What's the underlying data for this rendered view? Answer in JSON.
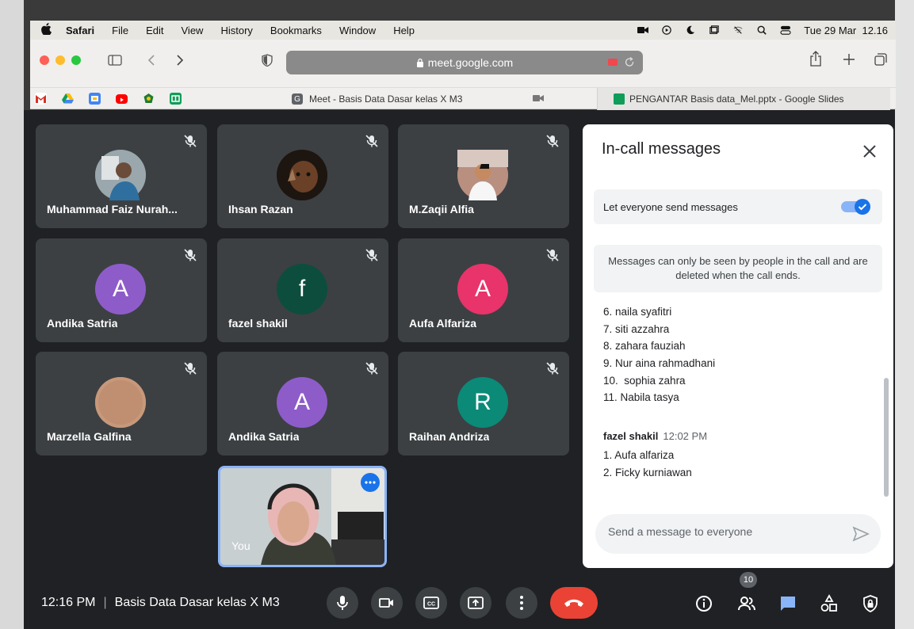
{
  "menubar": {
    "app": "Safari",
    "items": [
      "File",
      "Edit",
      "View",
      "History",
      "Bookmarks",
      "Window",
      "Help"
    ],
    "datetime": "Tue 29 Mar  12.16"
  },
  "browser": {
    "url": "meet.google.com",
    "tabs": [
      {
        "label": "Meet - Basis Data Dasar kelas X M3",
        "favicon": "meet-icon"
      },
      {
        "label": "PENGANTAR Basis data_Mel.pptx - Google Slides",
        "favicon": "slides-icon"
      }
    ],
    "bookmarks": [
      "gmail-icon",
      "drive-icon",
      "meet-icon",
      "youtube-icon",
      "emblem-icon",
      "slides-icon"
    ]
  },
  "participants": [
    {
      "name": "Muhammad Faiz Nurah...",
      "avatar_type": "photo",
      "avatar_color": "#7a8a96"
    },
    {
      "name": "Ihsan Razan",
      "avatar_type": "photo",
      "avatar_color": "#3b2a1c"
    },
    {
      "name": "M.Zaqii Alfia",
      "avatar_type": "photo",
      "avatar_color": "#8c6a5a"
    },
    {
      "name": "Andika Satria",
      "avatar_type": "letter",
      "initial": "A",
      "avatar_color": "#8e5cc9"
    },
    {
      "name": "fazel shakil",
      "avatar_type": "letter",
      "initial": "f",
      "avatar_color": "#0d4d3d"
    },
    {
      "name": "Aufa Alfariza",
      "avatar_type": "letter",
      "initial": "A",
      "avatar_color": "#e8336b"
    },
    {
      "name": "Marzella Galfina",
      "avatar_type": "photo",
      "avatar_color": "#c79a7c"
    },
    {
      "name": "Andika Satria",
      "avatar_type": "letter",
      "initial": "A",
      "avatar_color": "#8e5cc9"
    },
    {
      "name": "Raihan Andriza",
      "avatar_type": "letter",
      "initial": "R",
      "avatar_color": "#0b8a78"
    }
  ],
  "self_tile": {
    "label": "You"
  },
  "chat": {
    "title": "In-call messages",
    "toggle_label": "Let everyone send messages",
    "toggle_on": true,
    "notice": "Messages can only be seen by people in the call and are deleted when the call ends.",
    "previous_lines": [
      "6. naila syafitri",
      "7. siti azzahra",
      "8. zahara fauziah",
      "9. Nur aina rahmadhani",
      "10.  sophia zahra",
      "11. Nabila tasya"
    ],
    "sender": "fazel shakil",
    "sender_time": "12:02 PM",
    "lines": [
      "1. Aufa alfariza",
      "2. Ficky kurniawan"
    ],
    "compose_placeholder": "Send a message to everyone"
  },
  "bottom": {
    "time": "12:16 PM",
    "separator": "|",
    "meeting_name": "Basis Data Dasar kelas X M3",
    "people_count": "10"
  },
  "colors": {
    "meet_bg": "#202124",
    "tile_bg": "#3c4043",
    "accent_blue": "#1a73e8",
    "hangup_red": "#ea4335"
  }
}
